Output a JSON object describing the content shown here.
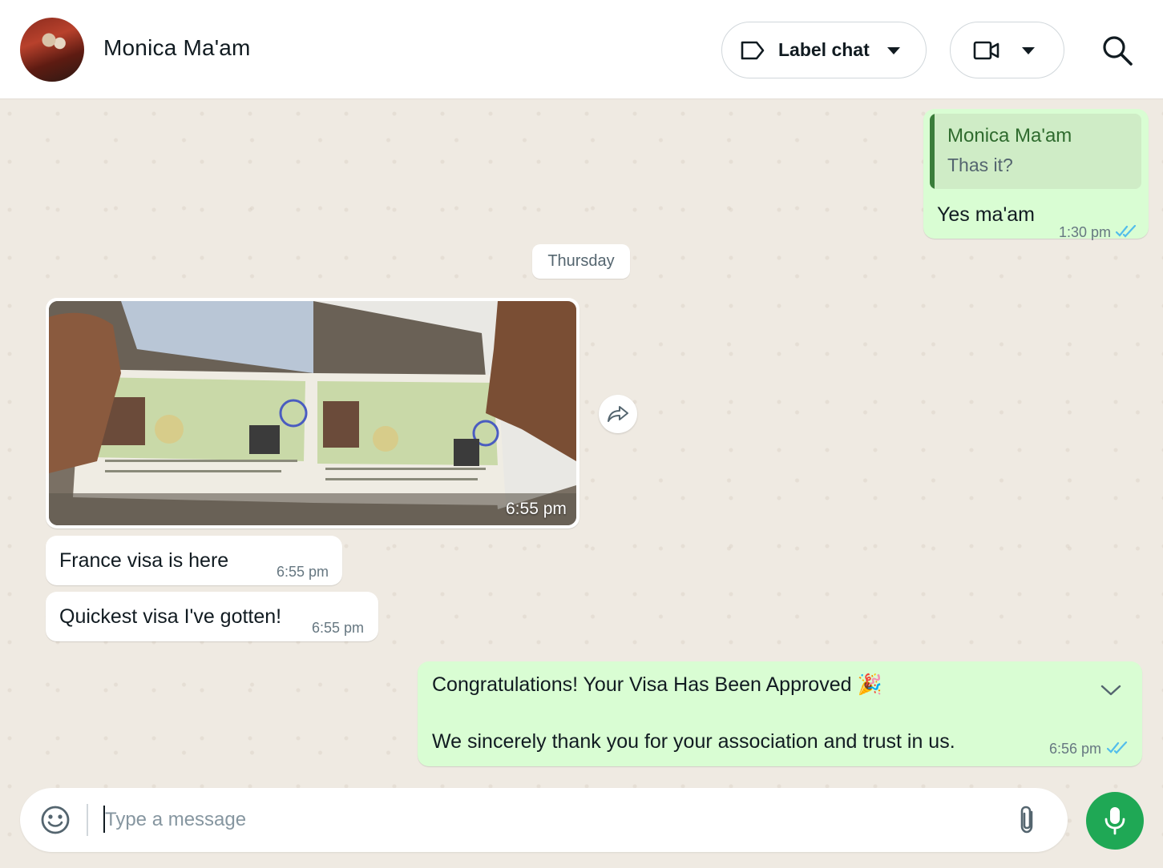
{
  "header": {
    "contact_name": "Monica Ma'am",
    "label_chat": "Label chat",
    "icons": {
      "label": "label-icon",
      "video": "video-call-icon",
      "search": "search-icon"
    }
  },
  "messages": {
    "m1": {
      "quoted_name": "Monica Ma'am",
      "quoted_text": "Thas it?",
      "text": "Yes ma'am",
      "time": "1:30 pm"
    },
    "day_chip": "Thursday",
    "m2": {
      "time": "6:55 pm"
    },
    "m3": {
      "text": "France visa is here",
      "time": "6:55 pm"
    },
    "m4": {
      "text": "Quickest visa I've gotten!",
      "time": "6:55 pm"
    },
    "m5": {
      "line1": "Congratulations! Your Visa Has Been Approved",
      "emoji": "🎉",
      "line2": "We sincerely thank you for your association and trust in us.",
      "time": "6:56 pm"
    }
  },
  "composer": {
    "placeholder": "Type a message"
  },
  "colors": {
    "outgoing": "#d9fdd3",
    "incoming": "#ffffff",
    "read_ticks": "#53bdeb",
    "mic": "#1fa855"
  }
}
